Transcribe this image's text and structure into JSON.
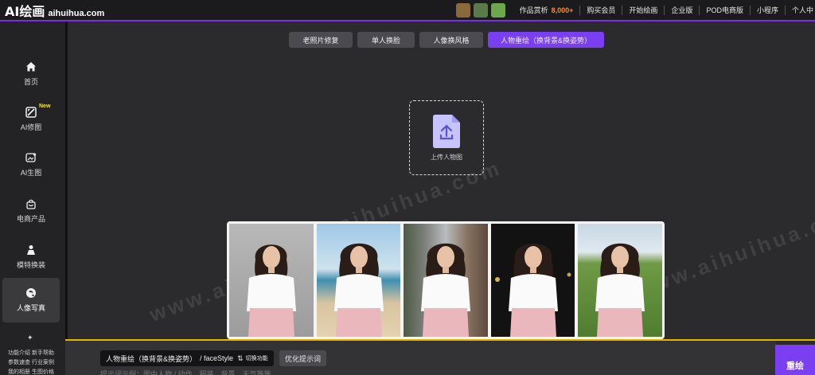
{
  "header": {
    "logo_main": "AI绘画",
    "logo_domain": "aihuihua.com",
    "gallery_label": "作品赏析",
    "gallery_count": "8,000+",
    "nav": [
      "购买会员",
      "开始绘画",
      "企业版",
      "POD电商版",
      "小程序",
      "个人中"
    ]
  },
  "sidebar": {
    "items": [
      {
        "label": "首页",
        "icon": "home-icon"
      },
      {
        "label": "AI修图",
        "icon": "ai-retouch-icon",
        "badge": "New"
      },
      {
        "label": "AI生图",
        "icon": "image-generate-icon"
      },
      {
        "label": "电商产品",
        "icon": "shopping-bag-icon"
      },
      {
        "label": "模特换装",
        "icon": "model-outfit-icon"
      },
      {
        "label": "人像写真",
        "icon": "portrait-icon",
        "active": true
      }
    ]
  },
  "tabs": [
    {
      "label": "老照片修复"
    },
    {
      "label": "单人换脸"
    },
    {
      "label": "人像换风格"
    },
    {
      "label": "人物重绘（换背景&换姿势）",
      "active": true
    }
  ],
  "upload": {
    "label": "上传人物图",
    "icon": "upload-file-icon"
  },
  "watermark": "www.aihuihua.com",
  "gallery": {
    "photos": [
      {
        "background": "studio-grey"
      },
      {
        "background": "beach"
      },
      {
        "background": "city-street"
      },
      {
        "background": "night"
      },
      {
        "background": "grass-field"
      }
    ]
  },
  "bottom": {
    "links_line1": "功能介绍 新手帮助",
    "links_line2": "参数速查 行业案例",
    "links_line3": "我的相册 生图价格",
    "prompt_chip": "人物重绘（换背景&换姿势）",
    "prompt_style": "/ faceStyle",
    "switch_label": "切换功能",
    "optimize_label": "优化提示词",
    "prompt_hint": "提示词示例：图中人物 / 动作、服装、背景、天气等等",
    "submit_label": "重绘"
  },
  "colors": {
    "accent": "#7b3ff2",
    "highlight": "#ff8a2a",
    "badge": "#ffe600"
  }
}
